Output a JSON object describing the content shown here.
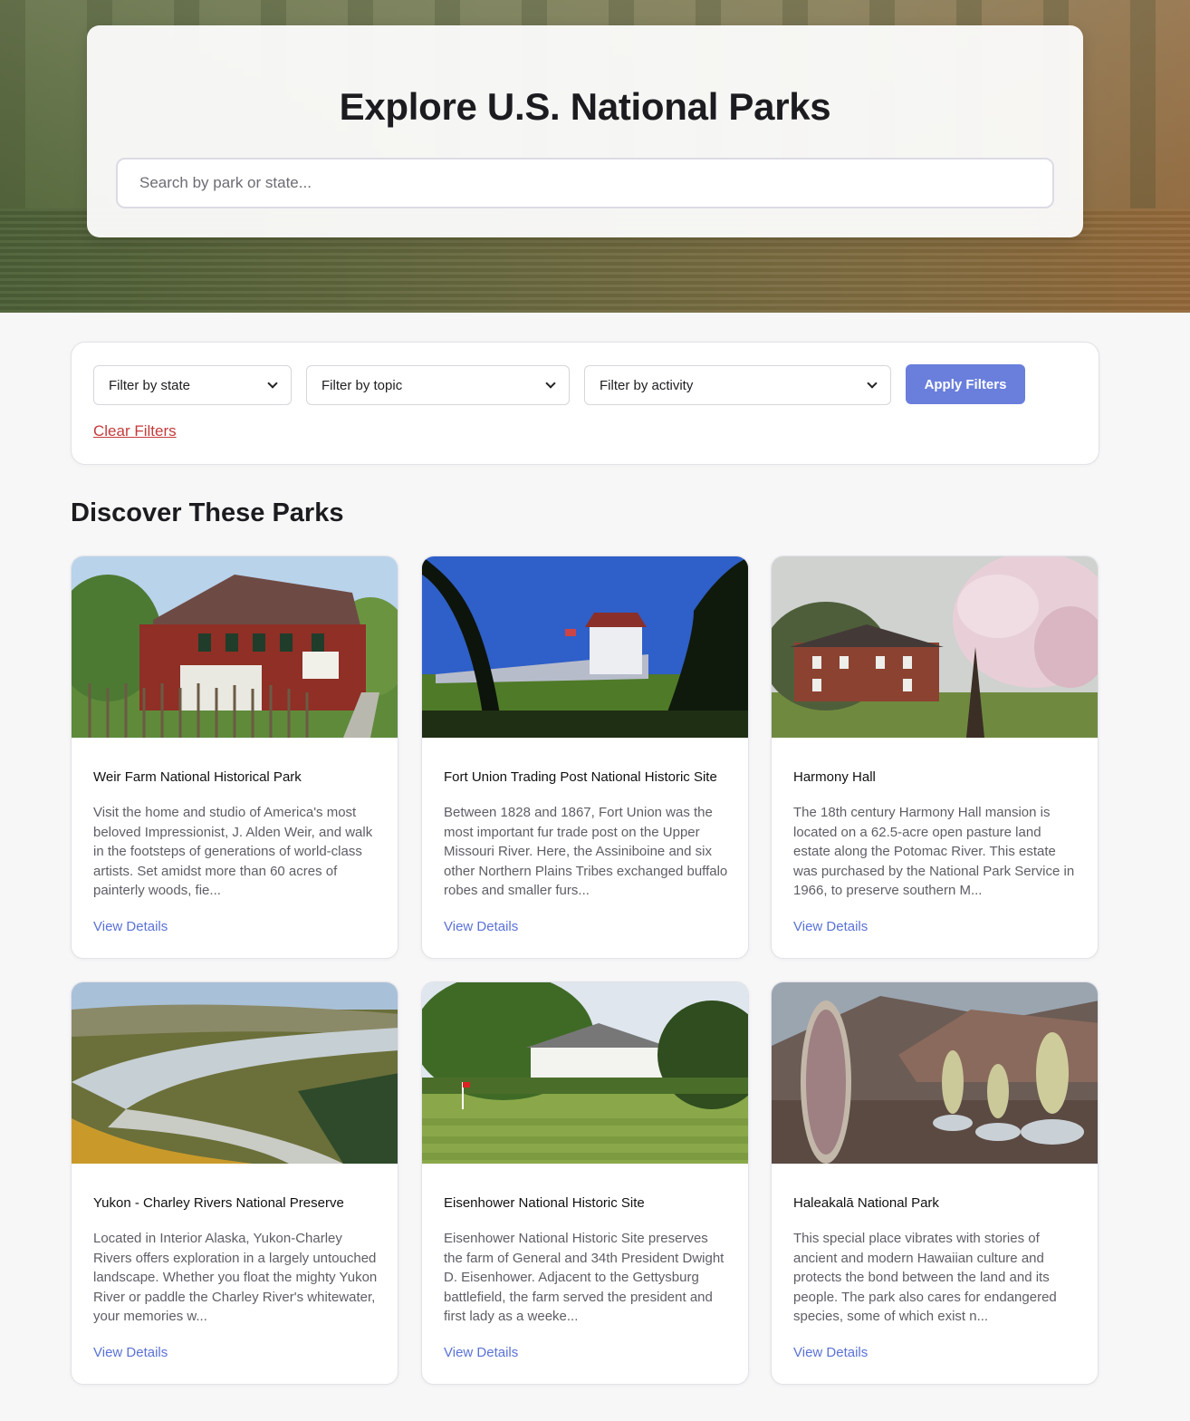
{
  "hero": {
    "title": "Explore U.S. National Parks",
    "search_placeholder": "Search by park or state..."
  },
  "filters": {
    "state": "Filter by state",
    "topic": "Filter by topic",
    "activity": "Filter by activity",
    "apply_label": "Apply Filters",
    "clear_label": "Clear Filters"
  },
  "section": {
    "title": "Discover These Parks"
  },
  "parks": [
    {
      "name": "Weir Farm National Historical Park",
      "description": "Visit the home and studio of America's most beloved Impressionist, J. Alden Weir, and walk in the footsteps of generations of world-class artists. Set amidst more than 60 acres of painterly woods, fie...",
      "link": "View Details"
    },
    {
      "name": "Fort Union Trading Post National Historic Site",
      "description": "Between 1828 and 1867, Fort Union was the most important fur trade post on the Upper Missouri River. Here, the Assiniboine and six other Northern Plains Tribes exchanged buffalo robes and smaller furs...",
      "link": "View Details"
    },
    {
      "name": "Harmony Hall",
      "description": "The 18th century Harmony Hall mansion is located on a 62.5-acre open pasture land estate along the Potomac River. This estate was purchased by the National Park Service in 1966, to preserve southern M...",
      "link": "View Details"
    },
    {
      "name": "Yukon - Charley Rivers National Preserve",
      "description": "Located in Interior Alaska, Yukon-Charley Rivers offers exploration in a largely untouched landscape. Whether you float the mighty Yukon River or paddle the Charley River's whitewater, your memories w...",
      "link": "View Details"
    },
    {
      "name": "Eisenhower National Historic Site",
      "description": "Eisenhower National Historic Site preserves the farm of General and 34th President Dwight D. Eisenhower. Adjacent to the Gettysburg battlefield, the farm served the president and first lady as a weeke...",
      "link": "View Details"
    },
    {
      "name": "Haleakalā National Park",
      "description": "This special place vibrates with stories of ancient and modern Hawaiian culture and protects the bond between the land and its people. The park also cares for endangered species, some of which exist n...",
      "link": "View Details"
    }
  ],
  "colors": {
    "accent": "#6a7fdc",
    "link": "#5a72d6",
    "danger": "#c53b3b"
  }
}
